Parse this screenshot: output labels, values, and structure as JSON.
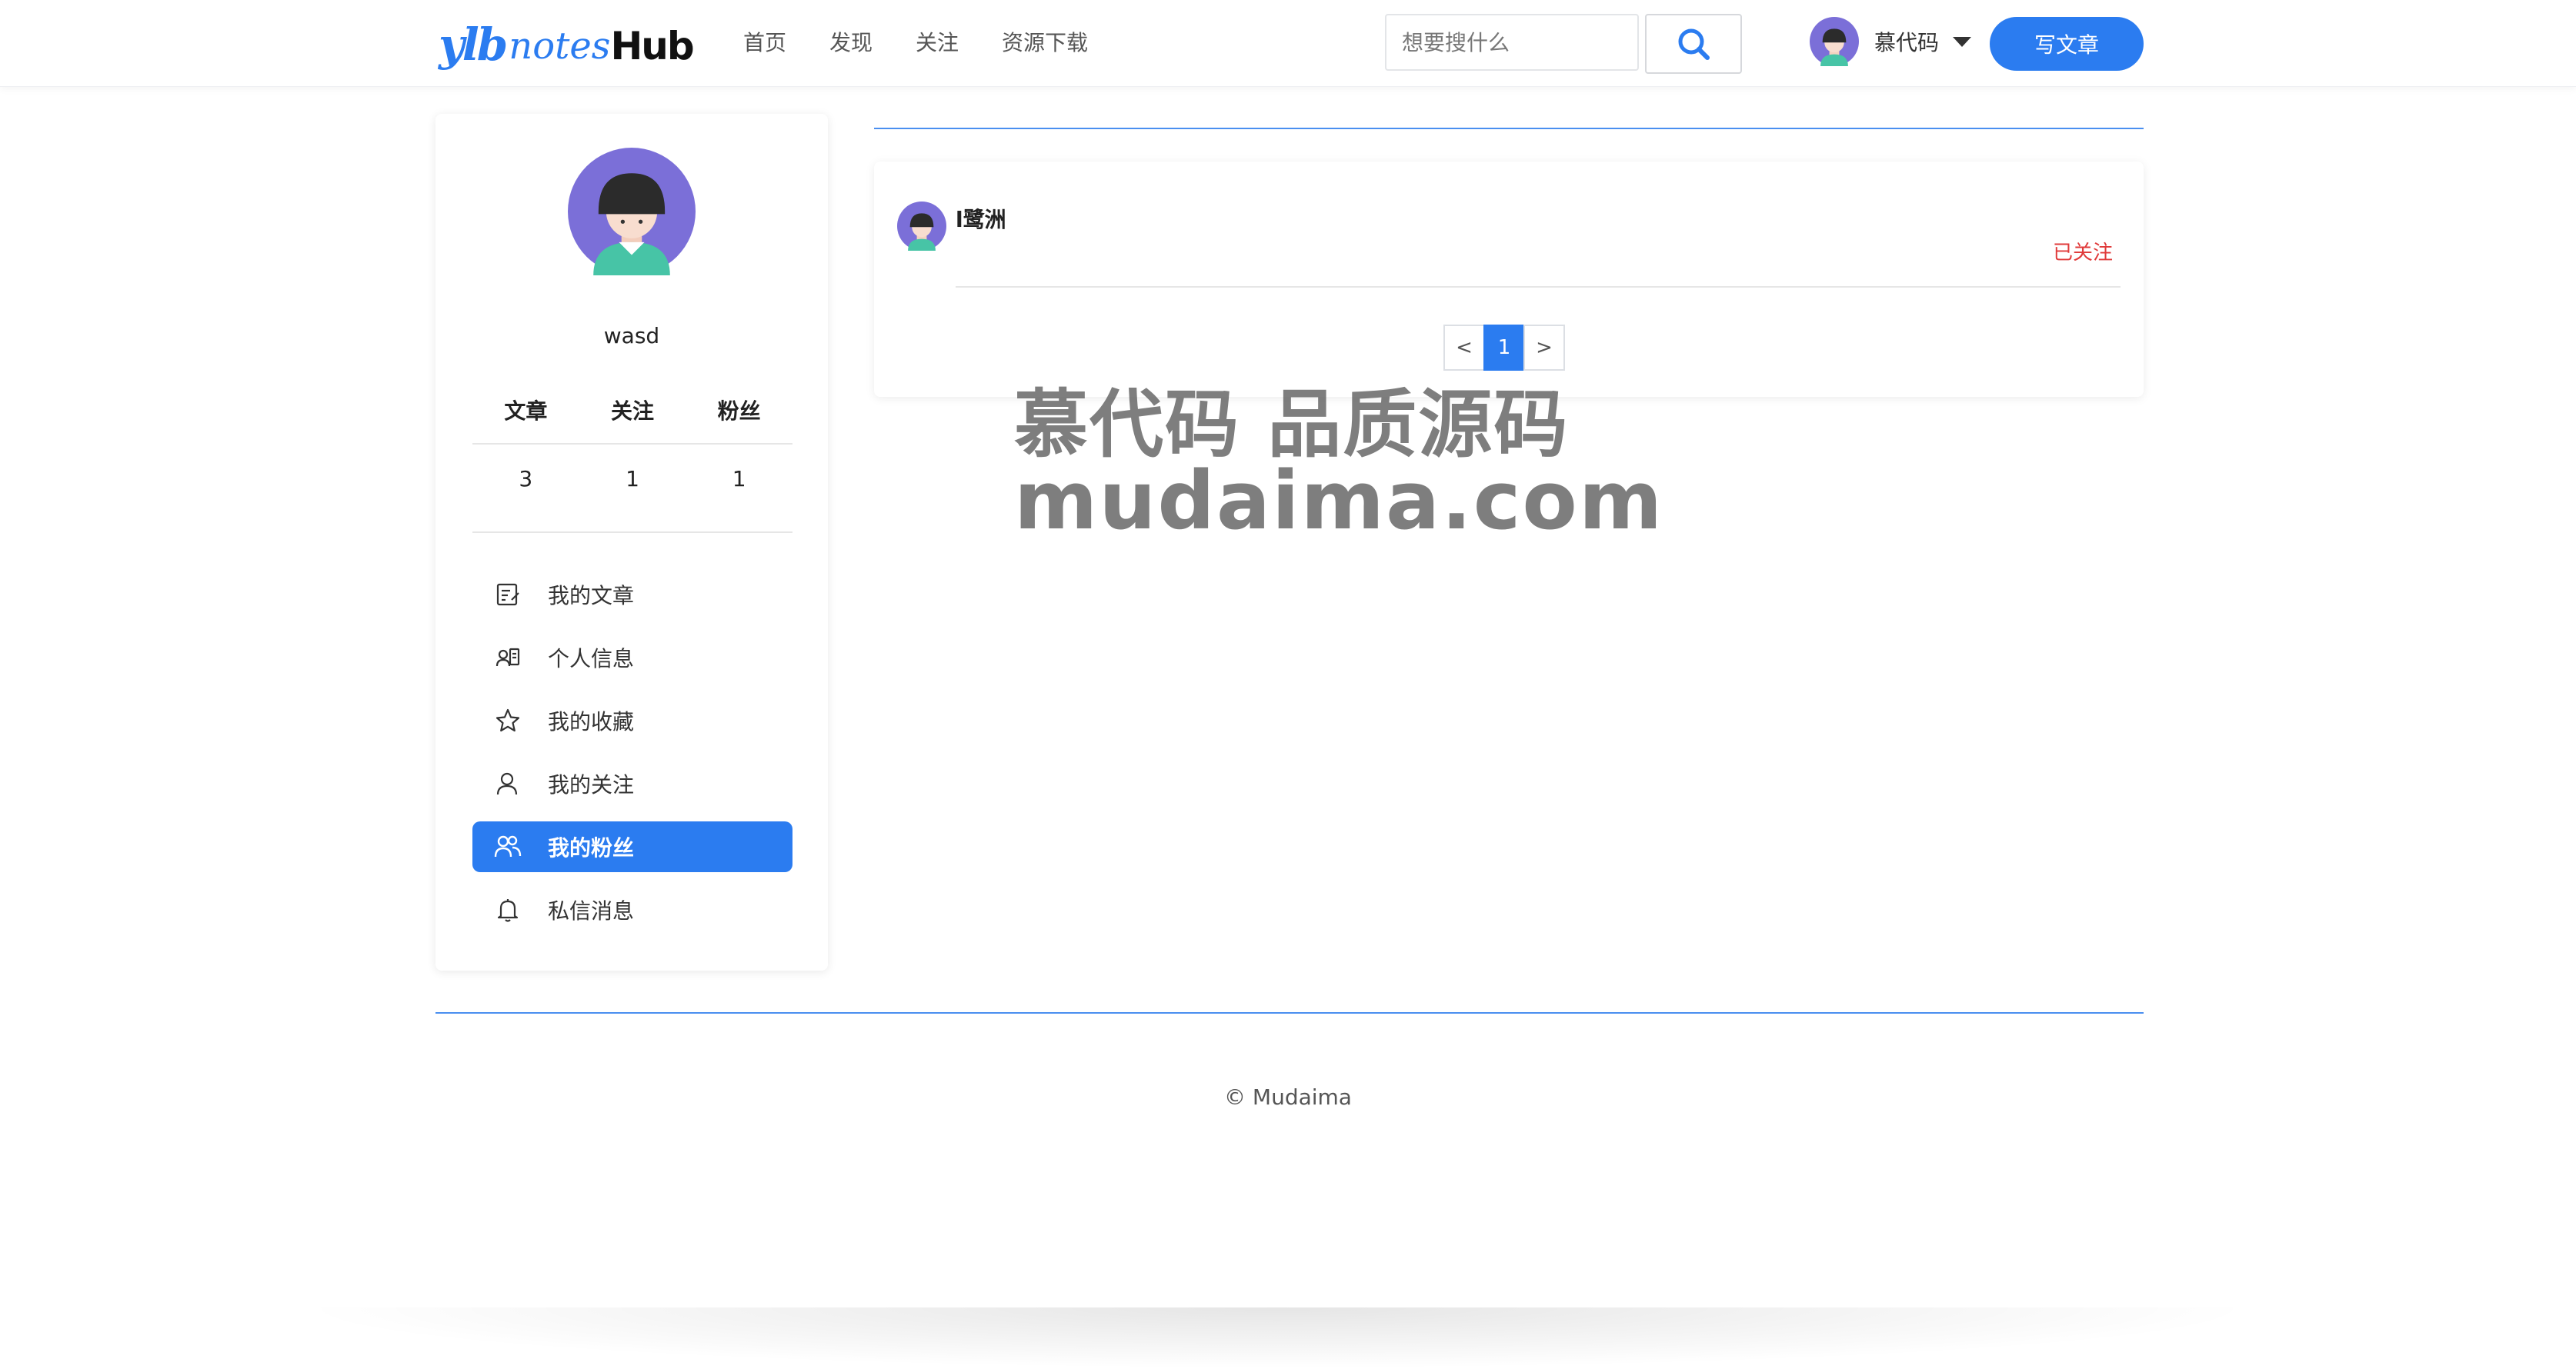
{
  "header": {
    "logo": {
      "part1": "ylb",
      "part2": "notes",
      "part3": "Hub"
    },
    "nav": [
      "首页",
      "发现",
      "关注",
      "资源下载"
    ],
    "search": {
      "placeholder": "想要搜什么",
      "value": ""
    },
    "user": {
      "name": "慕代码"
    },
    "write_label": "写文章"
  },
  "sidebar": {
    "username": "wasd",
    "stats": {
      "labels": [
        "文章",
        "关注",
        "粉丝"
      ],
      "values": [
        "3",
        "1",
        "1"
      ]
    },
    "menu": [
      {
        "label": "我的文章",
        "icon": "edit-document-icon",
        "active": false
      },
      {
        "label": "个人信息",
        "icon": "id-card-icon",
        "active": false
      },
      {
        "label": "我的收藏",
        "icon": "star-icon",
        "active": false
      },
      {
        "label": "我的关注",
        "icon": "user-icon",
        "active": false
      },
      {
        "label": "我的粉丝",
        "icon": "users-icon",
        "active": true
      },
      {
        "label": "私信消息",
        "icon": "bell-icon",
        "active": false
      }
    ]
  },
  "fans": {
    "items": [
      {
        "name": "l鹭洲",
        "status": "已关注"
      }
    ],
    "pagination": {
      "prev": "<",
      "current": "1",
      "next": ">"
    }
  },
  "watermark": {
    "line1": "慕代码 品质源码",
    "line2": "mudaima.com"
  },
  "footer": {
    "copyright": "© Mudaima"
  },
  "colors": {
    "accent": "#2b7cf0",
    "followed": "#e03a3a",
    "avatar_bg": "#7b6fd8"
  }
}
